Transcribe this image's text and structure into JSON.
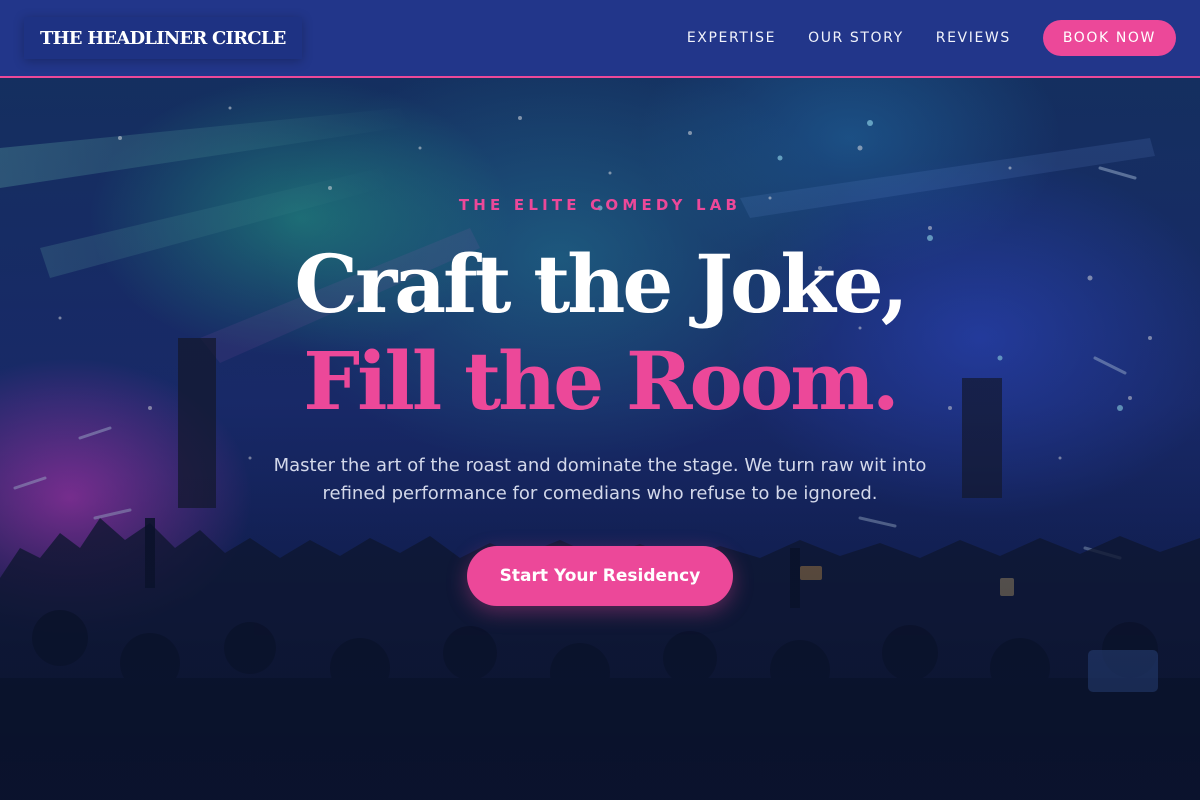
{
  "header": {
    "brand": "THE HEADLINER CIRCLE",
    "nav": [
      {
        "label": "EXPERTISE"
      },
      {
        "label": "OUR STORY"
      },
      {
        "label": "REVIEWS"
      }
    ],
    "cta_label": "BOOK NOW"
  },
  "hero": {
    "eyebrow": "THE ELITE COMEDY LAB",
    "headline_line1": "Craft the Joke,",
    "headline_line2": "Fill the Room.",
    "subtext": "Master the art of the roast and dominate the stage. We turn raw wit into refined performance for comedians who refuse to be ignored.",
    "cta_label": "Start Your Residency",
    "background": "concert-crowd-photo"
  },
  "colors": {
    "accent": "#ec4899",
    "nav_background": "#22368a",
    "text_light": "#ffffff",
    "subtext": "#d3d8ea"
  }
}
